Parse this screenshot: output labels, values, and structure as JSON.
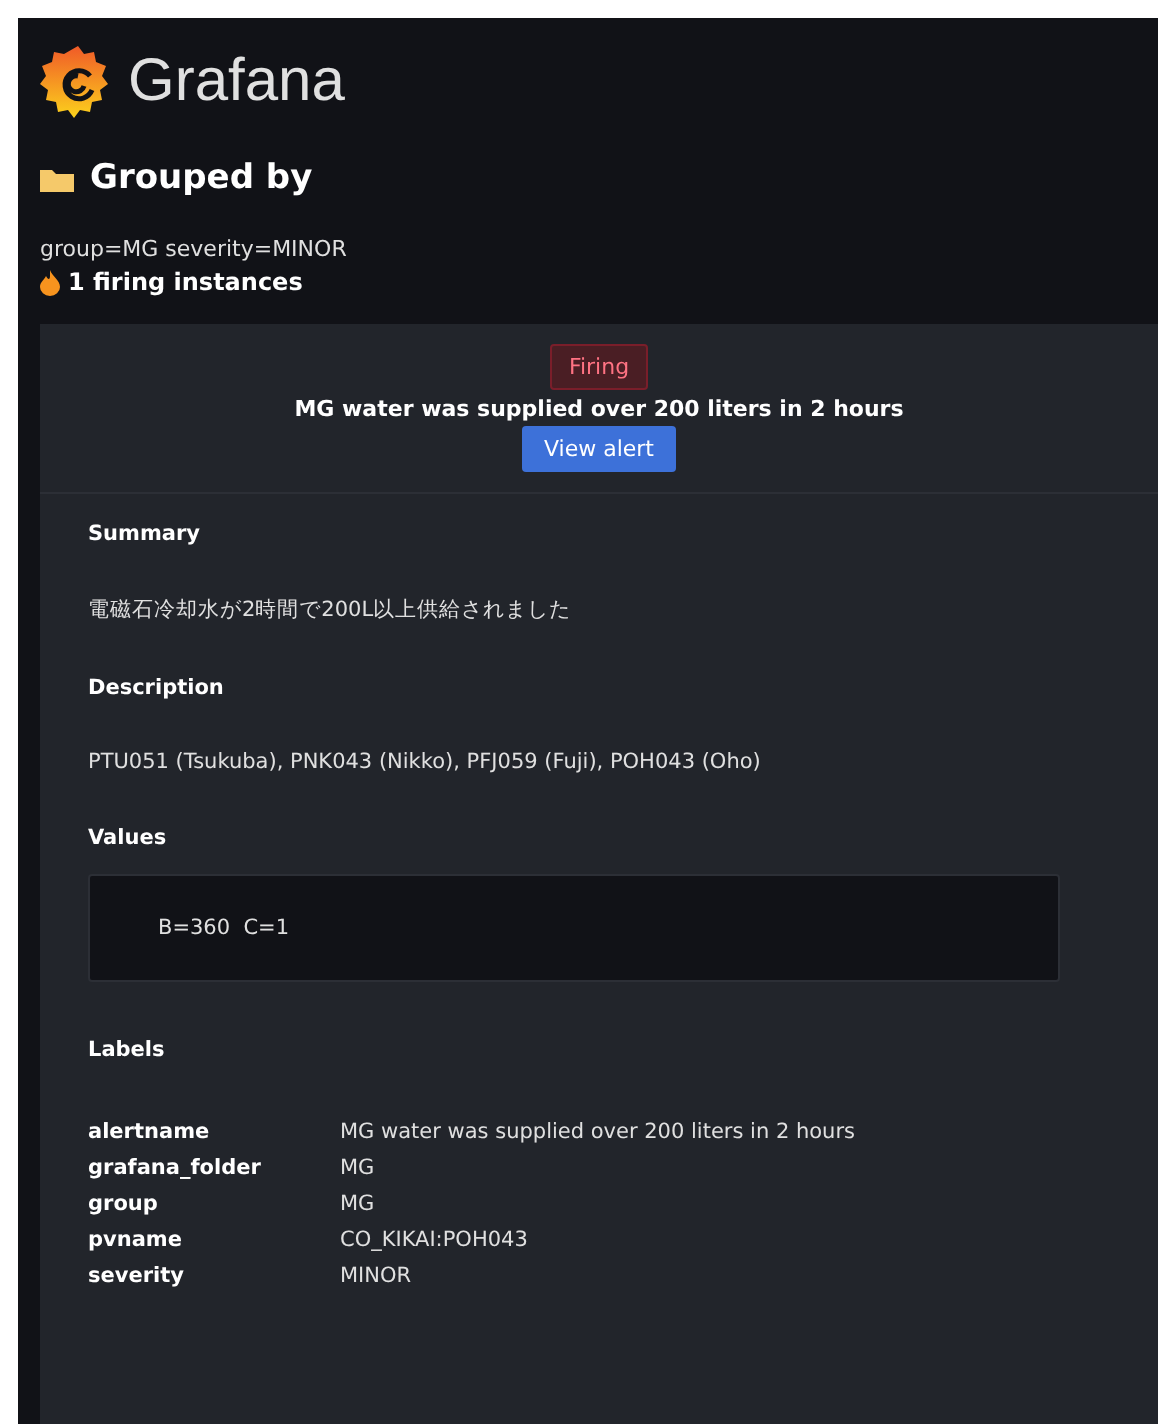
{
  "brand": "Grafana",
  "heading": "Grouped by",
  "group_labels": "group=MG severity=MINOR",
  "firing_count": "1 firing instances",
  "alert": {
    "state": "Firing",
    "title": "MG water was supplied over 200 liters in 2 hours",
    "button": "View alert"
  },
  "sections": [
    {
      "kind": "text",
      "title": "Summary",
      "text": "電磁石冷却水が2時間で200L以上供給されました"
    },
    {
      "kind": "text",
      "title": "Description",
      "text": "PTU051 (Tsukuba), PNK043 (Nikko), PFJ059 (Fuji), POH043 (Oho)"
    },
    {
      "kind": "code",
      "title": "Values",
      "text": "B=360  C=1"
    },
    {
      "kind": "labels",
      "title": "Labels",
      "labels": [
        {
          "key": "alertname",
          "value": "MG water was supplied over 200 liters in 2 hours"
        },
        {
          "key": "grafana_folder",
          "value": "MG"
        },
        {
          "key": "group",
          "value": "MG"
        },
        {
          "key": "pvname",
          "value": "CO_KIKAI:POH043"
        },
        {
          "key": "severity",
          "value": "MINOR"
        }
      ]
    }
  ]
}
